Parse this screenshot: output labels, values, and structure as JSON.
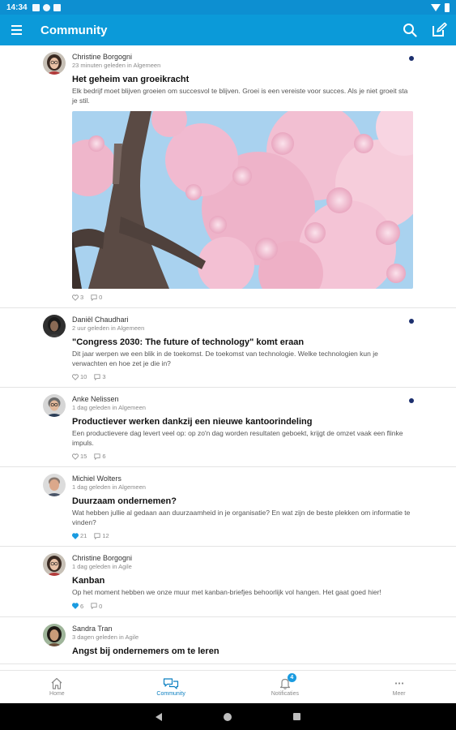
{
  "status_bar": {
    "time": "14:34"
  },
  "app_bar": {
    "title": "Community",
    "icons": {
      "menu": "hamburger-menu-icon",
      "search": "search-icon",
      "compose": "compose-icon"
    }
  },
  "posts": [
    {
      "author": "Christine Borgogni",
      "meta": "23 minuten geleden in Algemeen",
      "title": "Het geheim van groeikracht",
      "excerpt": "Elk bedrijf moet blijven groeien om succesvol te blijven. Groei is een vereiste voor succes. Als je niet groeit sta je stil.",
      "likes": "3",
      "comments": "0",
      "unread": true,
      "liked": false,
      "has_image": true
    },
    {
      "author": "Daniël Chaudhari",
      "meta": "2 uur geleden in Algemeen",
      "title": "\"Congress 2030: The future of technology\" komt eraan",
      "excerpt": "Dit jaar werpen we een blik in de toekomst. De toekomst van technologie. Welke technologien kun je verwachten en hoe zet je die in?",
      "likes": "10",
      "comments": "3",
      "unread": true,
      "liked": false
    },
    {
      "author": "Anke Nelissen",
      "meta": "1 dag geleden in Algemeen",
      "title": "Productiever werken dankzij een nieuwe kantoorindeling",
      "excerpt": "Een productievere dag levert veel op: op zo'n dag worden resultaten geboekt, krijgt de omzet vaak een flinke impuls.",
      "likes": "15",
      "comments": "6",
      "unread": true,
      "liked": false
    },
    {
      "author": "Michiel Wolters",
      "meta": "1 dag geleden in Algemeen",
      "title": "Duurzaam ondernemen?",
      "excerpt": "Wat hebben jullie al gedaan aan duurzaamheid in je organisatie? En wat zijn de beste plekken om informatie te vinden?",
      "likes": "21",
      "comments": "12",
      "unread": false,
      "liked": true
    },
    {
      "author": "Christine Borgogni",
      "meta": "1 dag geleden in Agile",
      "title": "Kanban",
      "excerpt": "Op het moment hebben we onze muur met kanban-briefjes behoorlijk vol hangen. Het gaat goed hier!",
      "likes": "6",
      "comments": "0",
      "unread": false,
      "liked": true
    },
    {
      "author": "Sandra Tran",
      "meta": "3 dagen geleden in Agile",
      "title": "Angst bij ondernemers om te leren",
      "excerpt": "",
      "likes": "",
      "comments": "",
      "unread": false,
      "liked": false
    }
  ],
  "bottom_nav": [
    {
      "label": "Home",
      "icon": "home-icon",
      "active": false
    },
    {
      "label": "Community",
      "icon": "chat-bubbles-icon",
      "active": true
    },
    {
      "label": "Notificaties",
      "icon": "bell-icon",
      "active": false,
      "badge": "4"
    },
    {
      "label": "Meer",
      "icon": "more-dots-icon",
      "active": false
    }
  ],
  "colors": {
    "primary": "#0b9ad9",
    "status_bar": "#0d8fd1",
    "unread_dot": "#1c2f6e",
    "active_nav": "#0b7fc1",
    "like_active": "#1a9be0"
  }
}
